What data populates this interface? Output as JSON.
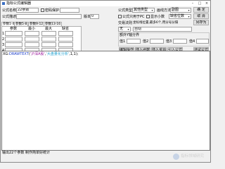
{
  "window": {
    "title": "指标公式编辑器",
    "controls": [
      "–",
      "□",
      "×"
    ]
  },
  "form": {
    "formula_name_label": "公式名称",
    "formula_name_value": "22参数",
    "password_label": "密码保护",
    "formula_type_label": "公式类型",
    "formula_type_value": "其他类型",
    "draw_method_label": "画线方法",
    "draw_method_value": "副图",
    "confirm_button": "确 定",
    "description_label": "公式描述",
    "description_value": "",
    "version_label": "版本",
    "version_value": "0",
    "cloud_label": "公式只用于PC",
    "show_small_label": "显示小数",
    "show_small_value": "缺省位数",
    "cancel_button": "取 消",
    "save_as_button": "另存为"
  },
  "param_tabs": [
    "参数1-4",
    "参数5-8",
    "参数9-12",
    "参数13-16"
  ],
  "param_grid": {
    "headers": [
      "参数",
      "最小",
      "最大",
      "缺省"
    ],
    "row_numbers": [
      "1",
      "2",
      "3",
      "4"
    ]
  },
  "right_panel": {
    "axis_label": "交易法则",
    "axis_sublabel": "坐标线位置,最多6个,用分号分隔",
    "axis_combo": "无",
    "auto_label": "自动",
    "extra_label": "额外Y轴分界",
    "level_labels": [
      "值1",
      "值2",
      "值3",
      "值4"
    ]
  },
  "buttons": {
    "edit_op": "编辑操作",
    "insert_func": "插入函数",
    "insert_resource": "插入资源",
    "import_formula": "引入公式",
    "test_formula": "测试公式",
    "use_in_chart": "应用于图",
    "insert_item": "插入项"
  },
  "code": {
    "prefix": "XG:",
    "func": "DRAWTEXT",
    "part1": "(",
    "str1": "'沪深A股'",
    "sep": ",",
    "str2": "'大盘量化分析'",
    "tail": ",1,1);"
  },
  "status": "输出22个参数  制作简单好统计",
  "watermark": "指标领域研究"
}
